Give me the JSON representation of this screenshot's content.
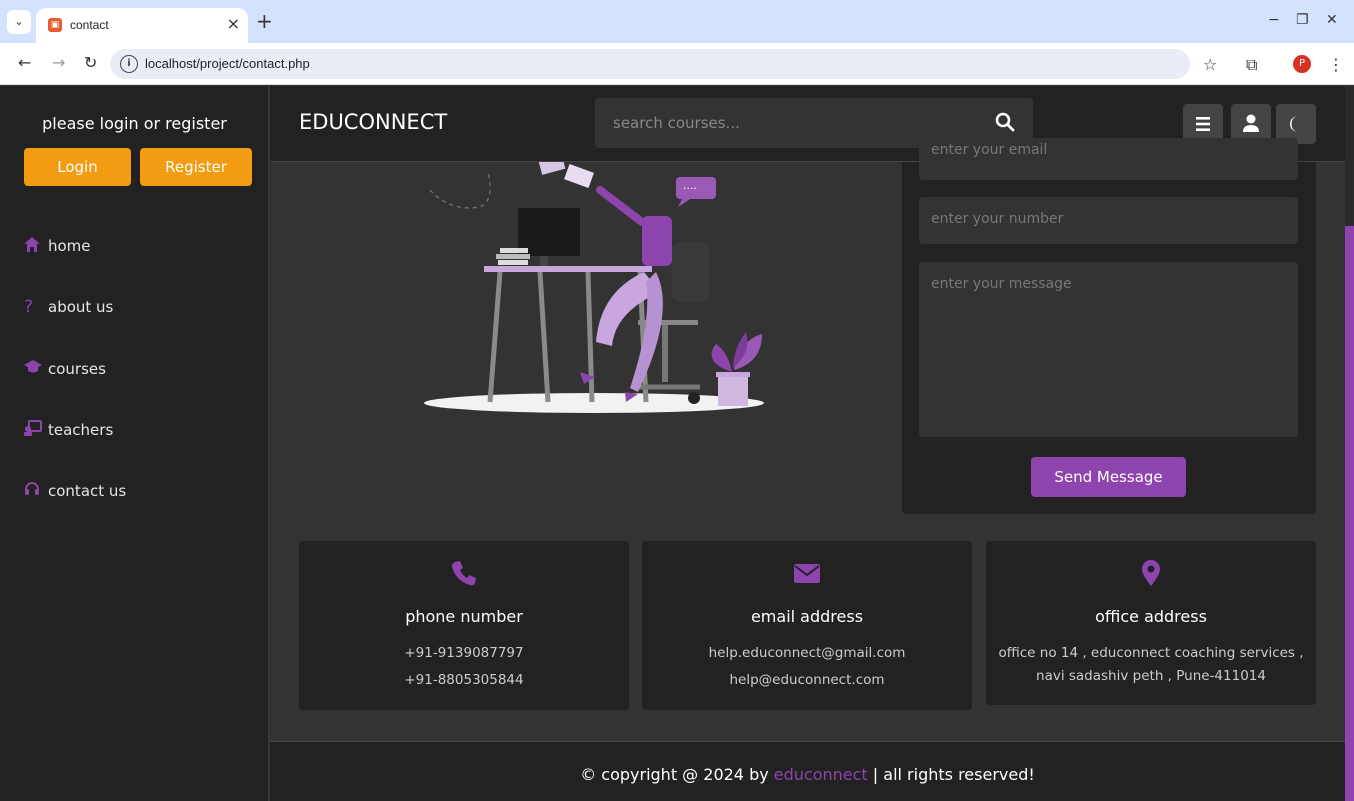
{
  "browser": {
    "tab_title": "contact",
    "url": "localhost/project/contact.php",
    "profile_initial": "P"
  },
  "sidebar": {
    "prompt": "please login or register",
    "login_label": "Login",
    "register_label": "Register",
    "items": [
      {
        "label": "home",
        "icon": "home-icon"
      },
      {
        "label": "about us",
        "icon": "question-icon"
      },
      {
        "label": "courses",
        "icon": "graduation-cap-icon"
      },
      {
        "label": "teachers",
        "icon": "chalkboard-teacher-icon"
      },
      {
        "label": "contact us",
        "icon": "headset-icon"
      }
    ]
  },
  "header": {
    "logo": "EDUCONNECT",
    "search_placeholder": "search courses..."
  },
  "form": {
    "email_placeholder": "enter your email",
    "number_placeholder": "enter your number",
    "message_placeholder": "enter your message",
    "send_label": "Send Message"
  },
  "cards": [
    {
      "title": "phone number",
      "lines": [
        "+91-9139087797",
        "+91-8805305844"
      ],
      "icon": "phone-icon"
    },
    {
      "title": "email address",
      "lines": [
        "help.educonnect@gmail.com",
        "help@educonnect.com"
      ],
      "icon": "envelope-icon"
    },
    {
      "title": "office address",
      "lines": [
        "office no 14 , educonnect coaching services ,",
        "navi sadashiv peth , Pune-411014"
      ],
      "icon": "map-marker-icon"
    }
  ],
  "footer": {
    "prefix": "© copyright @ 2024 by ",
    "brand": "educonnect",
    "suffix": " | all rights reserved!"
  },
  "colors": {
    "accent": "#8e44ad",
    "orange": "#f39c12",
    "panel": "#222222",
    "background": "#333333"
  }
}
